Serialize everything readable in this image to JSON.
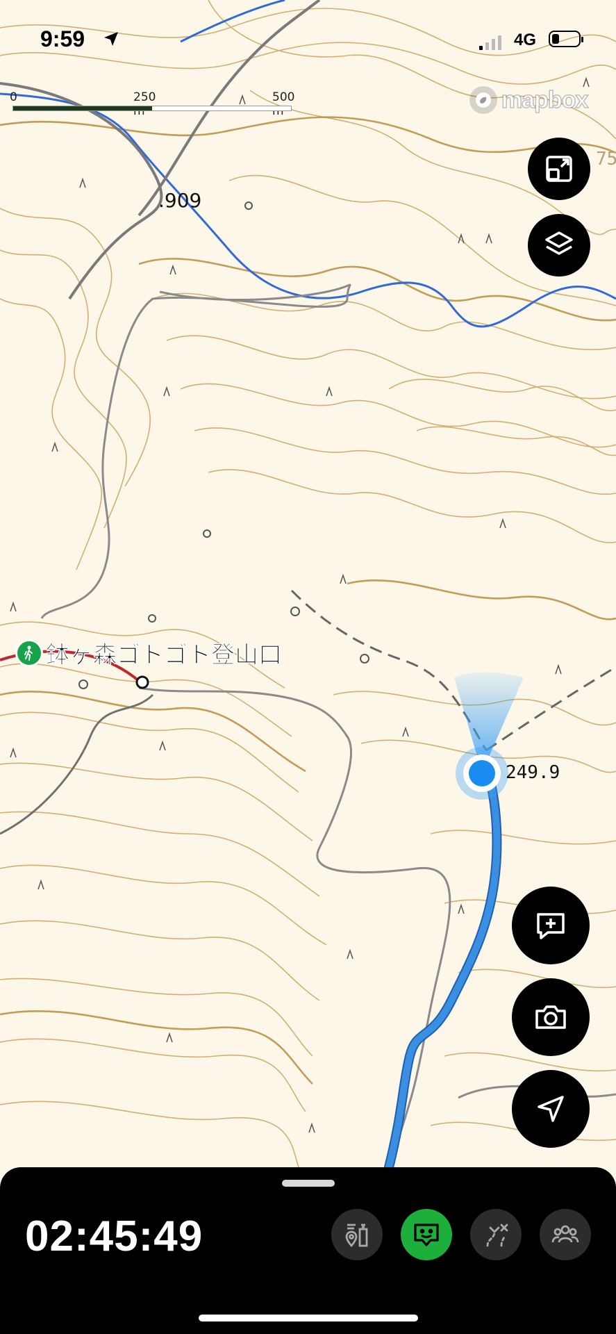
{
  "status_bar": {
    "time": "9:59",
    "network": "4G"
  },
  "map": {
    "scale": {
      "zero": "0",
      "mid": "250 m",
      "end": "500 m",
      "fill_fraction": 0.5
    },
    "attribution": "mapbox",
    "peak_label_1": ".909",
    "edge_label": "75",
    "current_elevation": "249.9",
    "trailhead_name": "鉢ヶ森ゴトゴト登山口"
  },
  "controls": {
    "fit_icon": "expand-arrows-icon",
    "layers_icon": "layers-icon",
    "add_note_icon": "message-plus-icon",
    "camera_icon": "camera-icon",
    "locate_icon": "navigation-arrow-icon"
  },
  "bottom_sheet": {
    "elapsed_time": "02:45:49",
    "tools": [
      {
        "icon": "map-pins-icon",
        "active": false
      },
      {
        "icon": "chat-face-icon",
        "active": true
      },
      {
        "icon": "route-off-icon",
        "active": false
      },
      {
        "icon": "group-icon",
        "active": false
      }
    ]
  },
  "colors": {
    "contour": "#c9a45a",
    "contour_index": "#b88c3c",
    "river": "#2f6ad8",
    "road": "#8a8a8a",
    "track": "#3b8fe0",
    "location": "#1a8cf0",
    "trail_red": "#c0262e",
    "active_tool": "#1eae3c"
  }
}
